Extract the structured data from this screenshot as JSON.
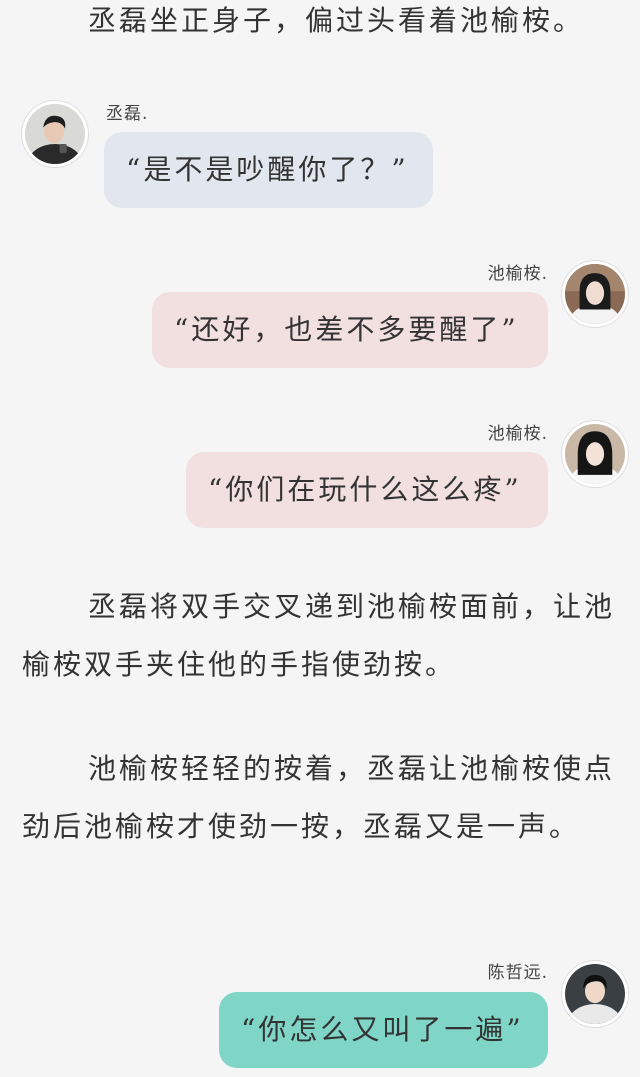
{
  "paragraphs": [
    {
      "text": "丞磊坐正身子，偏过头看着池榆桉。"
    },
    {
      "text": "丞磊将双手交叉递到池榆桉面前，让池榆桉双手夹住他的手指使劲按。"
    },
    {
      "text": "池榆桉轻轻的按着，丞磊让池榆桉使点劲后池榆桉才使劲一按，丞磊又是一声。"
    }
  ],
  "messages": [
    {
      "name": "丞磊.",
      "text": "“是不是吵醒你了？”",
      "bubble_color": "#e2e7ef"
    },
    {
      "name": "池榆桉.",
      "text": "“还好，也差不多要醒了”",
      "bubble_color": "#f2dfe0"
    },
    {
      "name": "池榆桉.",
      "text": "“你们在玩什么这么疼”",
      "bubble_color": "#f2dfe0"
    },
    {
      "name": "陈哲远.",
      "text": "“你怎么又叫了一遍”",
      "bubble_color": "#7fd6c7"
    }
  ]
}
